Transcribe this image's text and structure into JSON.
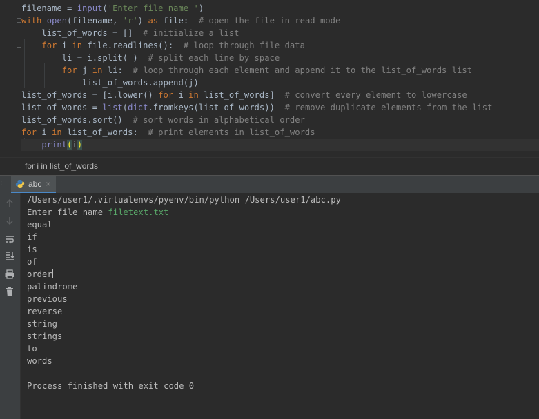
{
  "editor": {
    "lines": [
      [
        {
          "t": "filename = "
        },
        {
          "t": "input",
          "c": "bi"
        },
        {
          "t": "("
        },
        {
          "t": "'Enter file name '",
          "c": "str"
        },
        {
          "t": ")"
        }
      ],
      [
        {
          "t": "with ",
          "c": "kw"
        },
        {
          "t": "open",
          "c": "bi"
        },
        {
          "t": "(filename, "
        },
        {
          "t": "'r'",
          "c": "str"
        },
        {
          "t": ") "
        },
        {
          "t": "as ",
          "c": "kw"
        },
        {
          "t": "file:  "
        },
        {
          "t": "# open the file in read mode",
          "c": "cmt"
        }
      ],
      [
        {
          "t": "    list_of_words = []  "
        },
        {
          "t": "# initialize a list",
          "c": "cmt"
        }
      ],
      [
        {
          "t": "    "
        },
        {
          "t": "for ",
          "c": "kw"
        },
        {
          "t": "i "
        },
        {
          "t": "in ",
          "c": "kw"
        },
        {
          "t": "file.readlines():  "
        },
        {
          "t": "# loop through file data",
          "c": "cmt"
        }
      ],
      [
        {
          "t": "        li = i.split( )  "
        },
        {
          "t": "# split each line by space",
          "c": "cmt"
        }
      ],
      [
        {
          "t": "        "
        },
        {
          "t": "for ",
          "c": "kw"
        },
        {
          "t": "j "
        },
        {
          "t": "in ",
          "c": "kw"
        },
        {
          "t": "li:  "
        },
        {
          "t": "# loop through each element and append it to the list_of_words list",
          "c": "cmt"
        }
      ],
      [
        {
          "t": "            list_of_words.append(j)"
        }
      ],
      [
        {
          "t": "list_of_words = [i.lower() "
        },
        {
          "t": "for ",
          "c": "kw"
        },
        {
          "t": "i "
        },
        {
          "t": "in ",
          "c": "kw"
        },
        {
          "t": "list_of_words]  "
        },
        {
          "t": "# convert every element to lowercase",
          "c": "cmt"
        }
      ],
      [
        {
          "t": "list_of_words = "
        },
        {
          "t": "list",
          "c": "bi"
        },
        {
          "t": "("
        },
        {
          "t": "dict",
          "c": "bi"
        },
        {
          "t": ".fromkeys(list_of_words))  "
        },
        {
          "t": "# remove duplicate elements from the list",
          "c": "cmt"
        }
      ],
      [
        {
          "t": "list_of_words.sort()  "
        },
        {
          "t": "# sort words in alphabetical order",
          "c": "cmt"
        }
      ],
      [
        {
          "t": "for ",
          "c": "kw"
        },
        {
          "t": "i "
        },
        {
          "t": "in ",
          "c": "kw"
        },
        {
          "t": "list_of_words:  "
        },
        {
          "t": "# print elements in list_of_words",
          "c": "cmt"
        }
      ],
      [
        {
          "t": "    "
        },
        {
          "t": "print",
          "c": "bi"
        },
        {
          "t": "(",
          "c": "brace-match"
        },
        {
          "t": "i"
        },
        {
          "t": ")",
          "c": "brace-match"
        }
      ]
    ]
  },
  "breadcrumb": "for i in list_of_words",
  "run_tab": {
    "label": "abc",
    "close": "×"
  },
  "console": {
    "command": "/Users/user1/.virtualenvs/pyenv/bin/python /Users/user1/abc.py",
    "prompt": "Enter file name ",
    "user_input": "filetext.txt",
    "words_before_caret": [
      "equal",
      "if",
      "is",
      "of",
      "order"
    ],
    "words_after_caret": [
      "palindrome",
      "previous",
      "reverse",
      "string",
      "strings",
      "to",
      "words"
    ],
    "exit_message": "Process finished with exit code 0"
  },
  "toolbar_icons": [
    "up-arrow-icon",
    "down-arrow-icon",
    "soft-wrap-icon",
    "scroll-to-end-icon",
    "print-icon",
    "trash-icon"
  ],
  "colors": {
    "keyword": "#cc7832",
    "string": "#6a8759",
    "comment": "#808080",
    "builtin": "#8888c6",
    "console_input": "#59a869"
  }
}
